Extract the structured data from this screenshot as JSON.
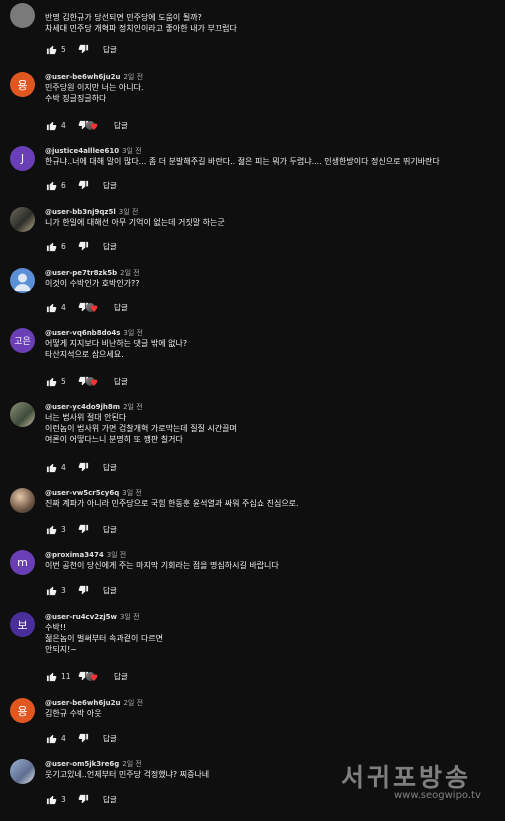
{
  "colors": {
    "background": "#0f0f0f",
    "avatar_orange": "#e0571f",
    "avatar_purple": "#6a3fb5",
    "avatar_lightblue": "#5b8fd6",
    "avatar_gray": "#7a7a7a",
    "heart": "#ff3333"
  },
  "reply_label": "답글",
  "comments": [
    {
      "handle": "",
      "time": "",
      "avatar_text": "",
      "lines": [
        "반명 김한규가 당선되면 민주당에 도움이  될까?",
        "차세대 민주당 개혁파 정치인이라고 좋아한 내가 부끄럽다"
      ],
      "likes": "5"
    },
    {
      "handle": "@user-be6wh6ju2u",
      "time": "2일 전",
      "avatar_text": "용",
      "lines": [
        "민주당원 이지만 너는 아니다.",
        "수박 징글징글하다"
      ],
      "likes": "4"
    },
    {
      "handle": "@justice4alllee610",
      "time": "3일 전",
      "avatar_text": "J",
      "lines": [
        "한규냐..너에 대해 말이 많다... 좀 더 분발해주길 바란다.. 젊은 피는 뭐가 두렵냐.... 인생한방이다 정신으로 뛰기바란다"
      ],
      "likes": "6"
    },
    {
      "handle": "@user-bb3nj9qz5l",
      "time": "3일 전",
      "avatar_text": "",
      "lines": [
        "니가  한일에 대해선 아무 기억이  없는데 거짓말 하는군"
      ],
      "likes": "6"
    },
    {
      "handle": "@user-pe7tr8zk5b",
      "time": "2일 전",
      "avatar_text": "",
      "lines": [
        "이것이 수박인가 호박인가??"
      ],
      "likes": "4"
    },
    {
      "handle": "@user-vq6nb8do4s",
      "time": "3일 전",
      "avatar_text": "고은",
      "lines": [
        "어떻게 지지보다 비난하는 댓글 밖에 없나?",
        "타산지석으로 삼으세요."
      ],
      "likes": "5"
    },
    {
      "handle": "@user-yc4do9jh8m",
      "time": "2일 전",
      "avatar_text": "",
      "lines": [
        "너는 법사위 절대 안된다",
        "이런놈이 법사위 가면 검찰개혁 가로막는데 질질 시간끌며",
        "여론이 어떻다느니 분명히 또 깽판 칠거다"
      ],
      "likes": "4"
    },
    {
      "handle": "@user-vw5cr5cy6q",
      "time": "3일 전",
      "avatar_text": "",
      "lines": [
        "진짜 계파가 아니라 민주당으로 국힘 한동훈 윤석열과 싸워 주십쇼 진심으로."
      ],
      "likes": "3"
    },
    {
      "handle": "@proxima3474",
      "time": "3일 전",
      "avatar_text": "m",
      "lines": [
        "이번 공천이 당신에게 주는 마지막 기회라는 점을 명심하시길 바랍니다"
      ],
      "likes": "3"
    },
    {
      "handle": "@user-ru4cv2zj5w",
      "time": "3일 전",
      "avatar_text": "보",
      "lines": [
        "수박!!",
        "젊은놈이 벌써부터  속과겉이 다르면",
        "안되지!~"
      ],
      "likes": "11"
    },
    {
      "handle": "@user-be6wh6ju2u",
      "time": "2일 전",
      "avatar_text": "용",
      "lines": [
        "김한규 수박 아웃"
      ],
      "likes": "4"
    },
    {
      "handle": "@user-om5jk3re6g",
      "time": "2일 전",
      "avatar_text": "",
      "lines": [
        "웃기고있네..언제부터 민주당 걱정했냐?  찌증나네"
      ],
      "likes": "3"
    }
  ],
  "watermark": {
    "logo": "서귀포방송",
    "url": "www.seogwipo.tv"
  }
}
